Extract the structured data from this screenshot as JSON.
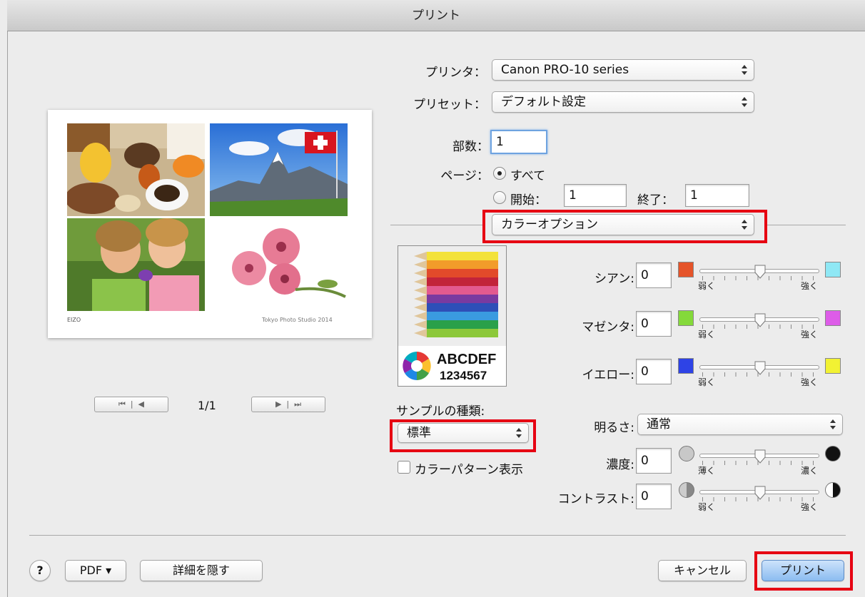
{
  "window": {
    "title": "プリント"
  },
  "preview": {
    "footer_left": "EIZO",
    "footer_right": "Tokyo Photo Studio 2014",
    "page_indicator": "1/1"
  },
  "printer": {
    "label": "プリンタ：",
    "value": "Canon PRO-10 series"
  },
  "preset": {
    "label": "プリセット：",
    "value": "デフォルト設定"
  },
  "copies": {
    "label": "部数：",
    "value": "1"
  },
  "pages": {
    "label": "ページ：",
    "all_label": "すべて",
    "from_label": "開始：",
    "from_value": "1",
    "to_label": "終了：",
    "to_value": "1",
    "selected": "all"
  },
  "panel_popup": {
    "value": "カラーオプション"
  },
  "sample": {
    "text1": "ABCDEF",
    "text2": "1234567",
    "type_label": "サンプルの種類:",
    "type_value": "標準",
    "color_pattern_label": "カラーパターン表示",
    "color_pattern_checked": false
  },
  "adjust": {
    "cyan": {
      "label": "シアン:",
      "value": "0",
      "lo": "弱く",
      "hi": "強く",
      "lo_color": "#e5542a",
      "hi_color": "#8fe8f5",
      "level": 0
    },
    "magenta": {
      "label": "マゼンタ:",
      "value": "0",
      "lo": "弱く",
      "hi": "強く",
      "lo_color": "#84d93a",
      "hi_color": "#dd5ce8",
      "level": 0
    },
    "yellow": {
      "label": "イエロー:",
      "value": "0",
      "lo": "弱く",
      "hi": "強く",
      "lo_color": "#2e43e6",
      "hi_color": "#f2f233",
      "level": 0
    },
    "brightness": {
      "label": "明るさ:",
      "value": "通常"
    },
    "density": {
      "label": "濃度:",
      "value": "0",
      "lo": "薄く",
      "hi": "濃く",
      "level": 0
    },
    "contrast": {
      "label": "コントラスト:",
      "value": "0",
      "lo": "弱く",
      "hi": "強く",
      "level": 0
    }
  },
  "bottom": {
    "help": "?",
    "pdf": "PDF ▾",
    "hide_details": "詳細を隠す",
    "cancel": "キャンセル",
    "print": "プリント"
  }
}
